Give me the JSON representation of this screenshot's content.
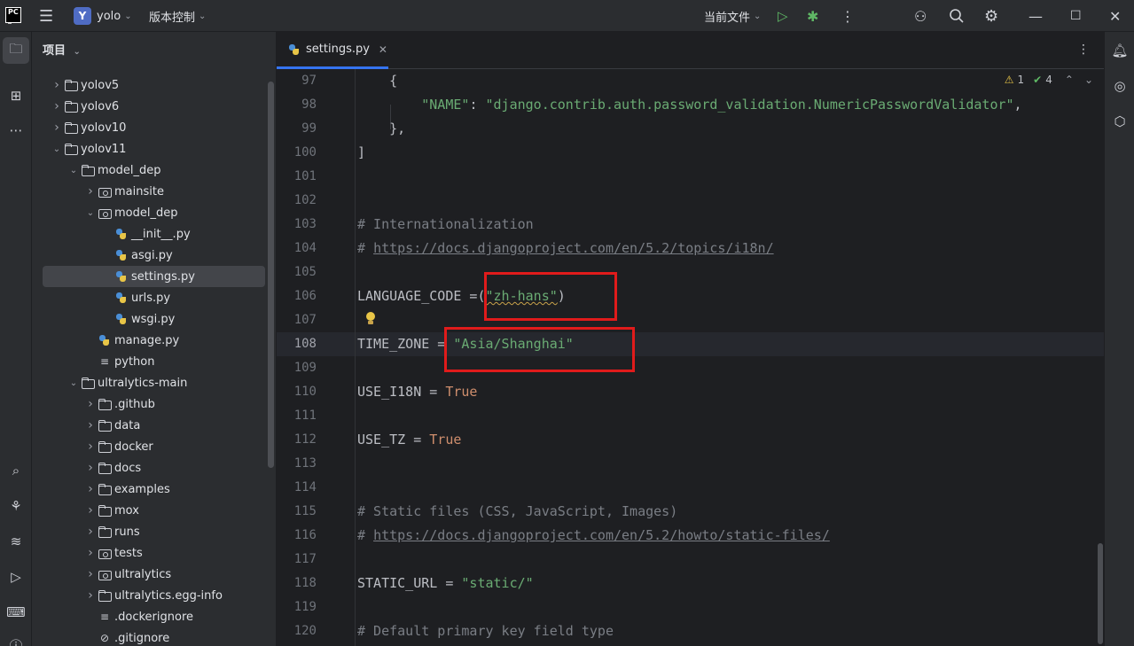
{
  "titlebar": {
    "project_initial": "Y",
    "project_name": "yolo",
    "vcs_label": "版本控制",
    "run_config": "当前文件"
  },
  "project_panel": {
    "title": "项目",
    "tree": [
      {
        "label": "yolov5",
        "indent": 1,
        "type": "folder",
        "expanded": false
      },
      {
        "label": "yolov6",
        "indent": 1,
        "type": "folder",
        "expanded": false
      },
      {
        "label": "yolov10",
        "indent": 1,
        "type": "folder",
        "expanded": false
      },
      {
        "label": "yolov11",
        "indent": 1,
        "type": "folder",
        "expanded": true
      },
      {
        "label": "model_dep",
        "indent": 2,
        "type": "folder",
        "expanded": true
      },
      {
        "label": "mainsite",
        "indent": 3,
        "type": "package",
        "expanded": false
      },
      {
        "label": "model_dep",
        "indent": 3,
        "type": "package",
        "expanded": true
      },
      {
        "label": "__init__.py",
        "indent": 4,
        "type": "py"
      },
      {
        "label": "asgi.py",
        "indent": 4,
        "type": "py"
      },
      {
        "label": "settings.py",
        "indent": 4,
        "type": "py",
        "selected": true
      },
      {
        "label": "urls.py",
        "indent": 4,
        "type": "py"
      },
      {
        "label": "wsgi.py",
        "indent": 4,
        "type": "py"
      },
      {
        "label": "manage.py",
        "indent": 3,
        "type": "py"
      },
      {
        "label": "python",
        "indent": 3,
        "type": "text"
      },
      {
        "label": "ultralytics-main",
        "indent": 2,
        "type": "folder",
        "expanded": true
      },
      {
        "label": ".github",
        "indent": 3,
        "type": "folder",
        "expanded": false
      },
      {
        "label": "data",
        "indent": 3,
        "type": "folder",
        "expanded": false
      },
      {
        "label": "docker",
        "indent": 3,
        "type": "folder",
        "expanded": false
      },
      {
        "label": "docs",
        "indent": 3,
        "type": "folder",
        "expanded": false
      },
      {
        "label": "examples",
        "indent": 3,
        "type": "folder",
        "expanded": false
      },
      {
        "label": "mox",
        "indent": 3,
        "type": "folder",
        "expanded": false
      },
      {
        "label": "runs",
        "indent": 3,
        "type": "folder",
        "expanded": false
      },
      {
        "label": "tests",
        "indent": 3,
        "type": "package",
        "expanded": false
      },
      {
        "label": "ultralytics",
        "indent": 3,
        "type": "package",
        "expanded": false
      },
      {
        "label": "ultralytics.egg-info",
        "indent": 3,
        "type": "folder",
        "expanded": false
      },
      {
        "label": ".dockerignore",
        "indent": 3,
        "type": "text"
      },
      {
        "label": ".gitignore",
        "indent": 3,
        "type": "ignore"
      }
    ]
  },
  "editor": {
    "tab_label": "settings.py",
    "inspection": {
      "warnings": "1",
      "checks": "4"
    },
    "line_numbers": [
      "97",
      "98",
      "99",
      "100",
      "101",
      "102",
      "103",
      "104",
      "105",
      "106",
      "107",
      "108",
      "109",
      "110",
      "111",
      "112",
      "113",
      "114",
      "115",
      "116",
      "117",
      "118",
      "119",
      "120"
    ],
    "current_line": "108",
    "lines": {
      "l97": "{",
      "l98_key": "\"NAME\"",
      "l98_sep": ": ",
      "l98_val": "\"django.contrib.auth.password_validation.NumericPasswordValidator\"",
      "l98_end": ",",
      "l99": "},",
      "l100": "]",
      "l103": "# Internationalization",
      "l104_prefix": "# ",
      "l104_link": "https://docs.djangoproject.com/en/5.2/topics/i18n/",
      "l106_name": "LANGUAGE_CODE =",
      "l106_open": "(",
      "l106_val": "\"zh-hans\"",
      "l106_close": ")",
      "l108_name": "TIME_ZONE = ",
      "l108_val": "\"Asia/Shanghai\"",
      "l110_name": "USE_I18N = ",
      "l110_val": "True",
      "l112_name": "USE_TZ = ",
      "l112_val": "True",
      "l115": "# Static files (CSS, JavaScript, Images)",
      "l116_prefix": "# ",
      "l116_link": "https://docs.djangoproject.com/en/5.2/howto/static-files/",
      "l118_name": "STATIC_URL = ",
      "l118_val": "\"static/\"",
      "l120": "# Default primary key field type"
    }
  },
  "colors": {
    "annotation_box": "#e01b1b",
    "accent": "#3574f0",
    "string": "#6aab73",
    "keyword": "#cf8e6d",
    "comment": "#7a7e85"
  }
}
